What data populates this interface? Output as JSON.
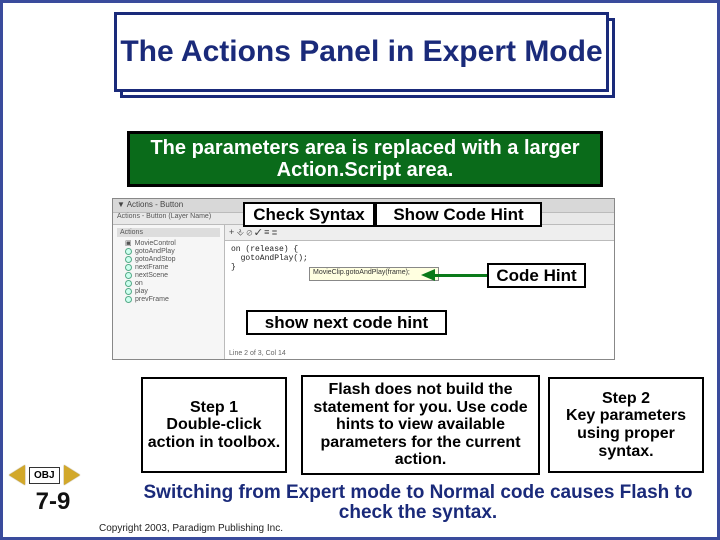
{
  "title": "The Actions Panel in Expert Mode",
  "banner": "The parameters area is replaced with a larger Action.Script area.",
  "labels": {
    "check_syntax": "Check Syntax",
    "show_code_hint": "Show Code Hint",
    "code_hint": "Code Hint",
    "show_next_code_hint": "show next code hint"
  },
  "boxes": {
    "step1": "Step 1\nDouble-click action in toolbox.",
    "mid": "Flash does not build the statement for you. Use code hints to view available parameters for the current action.",
    "step2": "Step 2\nKey parameters using proper syntax."
  },
  "switch_note": "Switching from Expert mode to Normal code causes Flash to check the syntax.",
  "copyright": "Copyright 2003, Paradigm Publishing Inc.",
  "nav": {
    "obj": "OBJ",
    "page": "7-9"
  },
  "flashpanel": {
    "title": "▼ Actions - Button",
    "sub": "Actions - Button (Layer Name)",
    "left_header": "Actions",
    "left_top": "MovieControl",
    "left_items": [
      "gotoAndPlay",
      "gotoAndStop",
      "nextFrame",
      "nextScene",
      "on",
      "play",
      "prevFrame"
    ],
    "toolbar": "+  ⎀  ⊘  ✓  ≡  ≣",
    "code_line1": "on (release) {",
    "code_line2": "  gotoAndPlay();",
    "code_line3": "}",
    "hint": "MovieClip.gotoAndPlay(frame);",
    "foot": "Line 2 of 3, Col 14"
  }
}
